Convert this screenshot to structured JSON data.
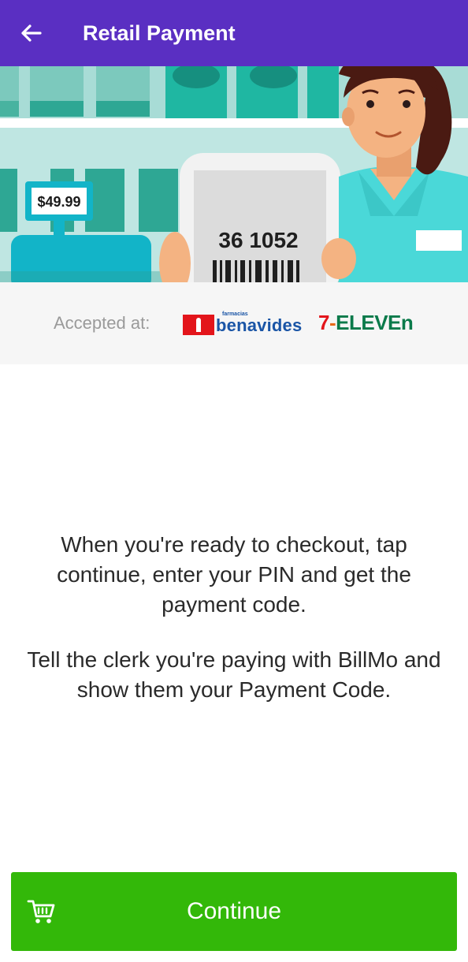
{
  "header": {
    "title": "Retail Payment",
    "back_icon": "arrow-left-icon"
  },
  "hero": {
    "price_tag": "$49.99",
    "receipt_code": "36 1052"
  },
  "accepted": {
    "label": "Accepted at:",
    "merchants": [
      {
        "name_small": "farmacias",
        "name": "benavides",
        "color": "#1a55a6",
        "mark_color": "#e3151b"
      },
      {
        "name_digit": "7",
        "name_dash": "-",
        "name": "ELEVEn",
        "digit_color": "#e3151b",
        "word_color": "#0a7a4a"
      }
    ]
  },
  "instructions": {
    "paragraph_1": "When you're ready to checkout, tap continue, enter your PIN and get the payment code.",
    "paragraph_2": "Tell the clerk you're paying with BillMo and show them your Payment Code."
  },
  "continue_button": {
    "label": "Continue",
    "icon": "shopping-cart-icon"
  },
  "colors": {
    "header_bg": "#5a2fc2",
    "button_bg": "#33b809",
    "strip_bg": "#f6f6f6"
  }
}
